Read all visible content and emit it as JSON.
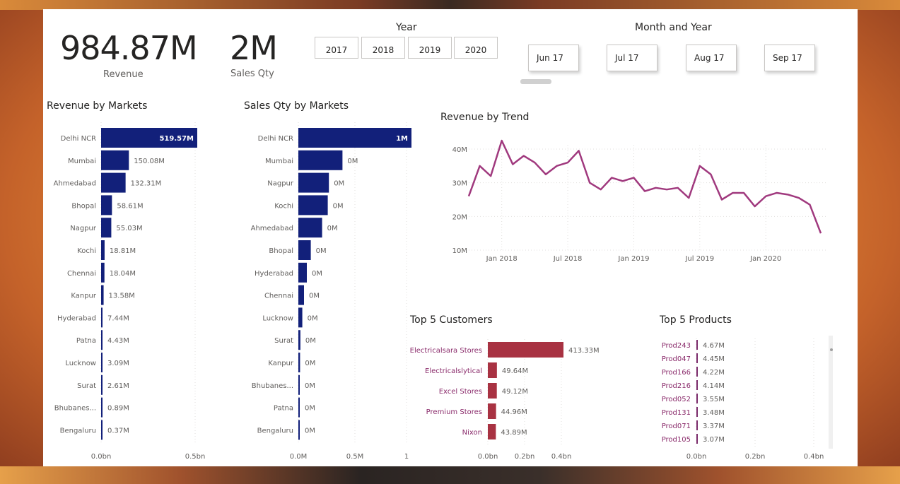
{
  "kpis": {
    "revenue_value": "984.87M",
    "revenue_label": "Revenue",
    "qty_value": "2M",
    "qty_label": "Sales Qty"
  },
  "year_slicer": {
    "title": "Year",
    "options": [
      "2017",
      "2018",
      "2019",
      "2020"
    ]
  },
  "month_slicer": {
    "title": "Month and Year",
    "options": [
      "Jun 17",
      "Jul 17",
      "Aug 17",
      "Sep 17"
    ]
  },
  "colors": {
    "navy": "#12207a",
    "line": "#a0397e",
    "customer_bar": "#a83242",
    "product_bar": "#7a2a6a"
  },
  "chart_data": [
    {
      "type": "bar",
      "title": "Revenue by Markets",
      "orientation": "horizontal",
      "categories": [
        "Delhi NCR",
        "Mumbai",
        "Ahmedabad",
        "Bhopal",
        "Nagpur",
        "Kochi",
        "Chennai",
        "Kanpur",
        "Hyderabad",
        "Patna",
        "Lucknow",
        "Surat",
        "Bhubanes...",
        "Bengaluru"
      ],
      "values": [
        519.57,
        150.08,
        132.31,
        58.61,
        55.03,
        18.81,
        18.04,
        13.58,
        7.44,
        4.43,
        3.09,
        2.61,
        0.89,
        0.37
      ],
      "labels": [
        "519.57M",
        "150.08M",
        "132.31M",
        "58.61M",
        "55.03M",
        "18.81M",
        "18.04M",
        "13.58M",
        "7.44M",
        "4.43M",
        "3.09M",
        "2.61M",
        "0.89M",
        "0.37M"
      ],
      "xlim": [
        0,
        520
      ],
      "xticks": [
        "0.0bn",
        "0.5bn"
      ]
    },
    {
      "type": "bar",
      "title": "Sales Qty by Markets",
      "orientation": "horizontal",
      "categories": [
        "Delhi NCR",
        "Mumbai",
        "Nagpur",
        "Kochi",
        "Ahmedabad",
        "Bhopal",
        "Hyderabad",
        "Chennai",
        "Lucknow",
        "Surat",
        "Kanpur",
        "Bhubanes...",
        "Patna",
        "Bengaluru"
      ],
      "values": [
        1000000,
        390000,
        270000,
        260000,
        210000,
        110000,
        75000,
        50000,
        35000,
        18000,
        15000,
        12000,
        4000,
        2000
      ],
      "labels": [
        "1M",
        "0M",
        "0M",
        "0M",
        "0M",
        "0M",
        "0M",
        "0M",
        "0M",
        "0M",
        "0M",
        "0M",
        "0M",
        "0M"
      ],
      "xlim": [
        0,
        1000000
      ],
      "xticks": [
        "0.0M",
        "0.5M",
        "1"
      ]
    },
    {
      "type": "line",
      "title": "Revenue by Trend",
      "x": [
        "2017-10",
        "2017-11",
        "2017-12",
        "2018-01",
        "2018-02",
        "2018-03",
        "2018-04",
        "2018-05",
        "2018-06",
        "2018-07",
        "2018-08",
        "2018-09",
        "2018-10",
        "2018-11",
        "2018-12",
        "2019-01",
        "2019-02",
        "2019-03",
        "2019-04",
        "2019-05",
        "2019-06",
        "2019-07",
        "2019-08",
        "2019-09",
        "2019-10",
        "2019-11",
        "2019-12",
        "2020-01",
        "2020-02",
        "2020-03",
        "2020-04",
        "2020-05",
        "2020-06"
      ],
      "values": [
        26,
        35,
        32,
        42.5,
        35.5,
        38,
        36,
        32.5,
        35,
        36,
        39.5,
        30,
        28,
        31.5,
        30.5,
        31.5,
        27.5,
        28.5,
        28,
        28.5,
        25.5,
        35,
        32.5,
        25,
        27,
        27,
        23,
        26,
        27,
        26.5,
        25.5,
        23.5,
        15
      ],
      "ylim": [
        10,
        42
      ],
      "yticks": [
        "10M",
        "20M",
        "30M",
        "40M"
      ],
      "xticks": [
        "Jan 2018",
        "Jul 2018",
        "Jan 2019",
        "Jul 2019",
        "Jan 2020"
      ]
    },
    {
      "type": "bar",
      "title": "Top 5 Customers",
      "orientation": "horizontal",
      "categories": [
        "Electricalsara Stores",
        "Electricalslytical",
        "Excel Stores",
        "Premium Stores",
        "Nixon"
      ],
      "values": [
        413.33,
        49.64,
        49.12,
        44.96,
        43.89
      ],
      "labels": [
        "413.33M",
        "49.64M",
        "49.12M",
        "44.96M",
        "43.89M"
      ],
      "xticks": [
        "0.0bn",
        "0.2bn",
        "0.4bn"
      ]
    },
    {
      "type": "bar",
      "title": "Top 5 Products",
      "orientation": "horizontal",
      "categories": [
        "Prod243",
        "Prod047",
        "Prod166",
        "Prod216",
        "Prod052",
        "Prod131",
        "Prod071",
        "Prod105"
      ],
      "values": [
        4.67,
        4.45,
        4.22,
        4.14,
        3.55,
        3.48,
        3.37,
        3.07
      ],
      "labels": [
        "4.67M",
        "4.45M",
        "4.22M",
        "4.14M",
        "3.55M",
        "3.48M",
        "3.37M",
        "3.07M"
      ],
      "xticks": [
        "0.0bn",
        "0.2bn",
        "0.4bn"
      ]
    }
  ]
}
